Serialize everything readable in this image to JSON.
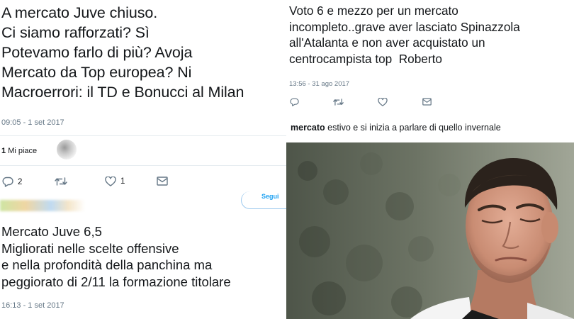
{
  "left": {
    "tweet1": {
      "lines": [
        "A mercato Juve chiuso.",
        "Ci siamo rafforzati? Sì",
        "Potevamo farlo di più? Avoja",
        "Mercato da Top europea? Ni",
        "Macroerrori: il TD e Bonucci al Milan"
      ],
      "timestamp": "09:05 - 1 set 2017",
      "likes_count": "1",
      "likes_label": "Mi piace",
      "reply_count": "2",
      "like_count": "1"
    },
    "follow_label": "Segui",
    "tweet2": {
      "lines": [
        "Mercato Juve 6,5",
        "Migliorati nelle scelte offensive",
        "e nella profondità della panchina ma",
        "peggiorato di 2/11 la formazione titolare"
      ],
      "timestamp": "16:13 - 1 set 2017"
    }
  },
  "right": {
    "tweet3": {
      "lines": [
        "Voto 6 e mezzo per un mercato",
        "incompleto..grave aver lasciato Spinazzola",
        "all'Atalanta e non aver acquistato un",
        "centrocampista top  Roberto"
      ],
      "timestamp": "13:56 - 31 ago 2017"
    },
    "caption_bold": "mercato",
    "caption_rest": " estivo e si inizia a parlare di quello invernale"
  },
  "icons": [
    "reply-icon",
    "retweet-icon",
    "heart-icon",
    "message-icon"
  ],
  "colors": {
    "muted": "#657786",
    "text": "#14171a",
    "link": "#1da1f2",
    "divider": "#e6ecf0"
  }
}
